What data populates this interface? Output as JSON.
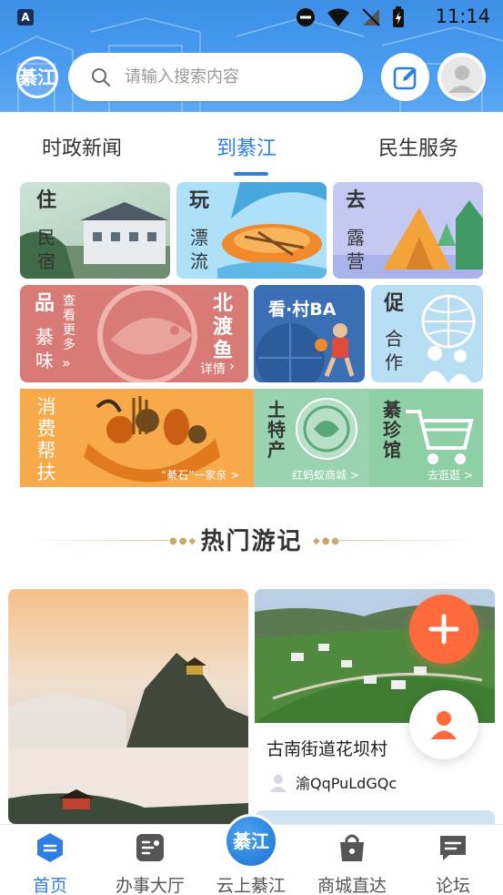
{
  "status_bar": {
    "time": "11:14",
    "carrier_badge": "A"
  },
  "header": {
    "logo_text": "綦江",
    "search": {
      "placeholder": "请输入搜索内容"
    },
    "icons": [
      "search-icon",
      "edit-icon",
      "avatar-icon"
    ]
  },
  "tabs": [
    {
      "label": "时政新闻",
      "active": false
    },
    {
      "label": "到綦江",
      "active": true
    },
    {
      "label": "民生服务",
      "active": false
    }
  ],
  "tiles": {
    "stay": {
      "title": "住",
      "sub": "民宿"
    },
    "play": {
      "title": "玩",
      "sub": "漂流"
    },
    "camp": {
      "title": "去",
      "sub": "露营"
    },
    "taste": {
      "title": "品",
      "sub": "綦味",
      "more": "查看更多",
      "fish": "北渡鱼",
      "detail": "详情"
    },
    "watch": {
      "title": "看·村BA"
    },
    "promote": {
      "title": "促",
      "sub": "合作"
    },
    "consume": {
      "title": "消费帮扶",
      "link": "“綦石”一家亲 >"
    },
    "local": {
      "title": "土特产",
      "link": "红蚂蚁商城 >"
    },
    "shop": {
      "title": "綦珍馆",
      "link": "去逛逛 >"
    }
  },
  "section": {
    "title": "热门游记"
  },
  "post": {
    "title": "古南街道花坝村",
    "author": "渝QqPuLdGQc"
  },
  "fab": {
    "add_label": "+"
  },
  "bottom_nav": [
    {
      "label": "首页",
      "icon": "home-icon",
      "active": true
    },
    {
      "label": "办事大厅",
      "icon": "service-hall-icon",
      "active": false
    },
    {
      "label": "云上綦江",
      "icon": "cloud-qijiang-logo-icon",
      "active": false
    },
    {
      "label": "商城直达",
      "icon": "shopping-bag-icon",
      "active": false
    },
    {
      "label": "论坛",
      "icon": "forum-icon",
      "active": false
    }
  ],
  "colors": {
    "accent": "#2f7fe0",
    "header": "#4a9cf0",
    "fab": "#ff6a3d"
  }
}
